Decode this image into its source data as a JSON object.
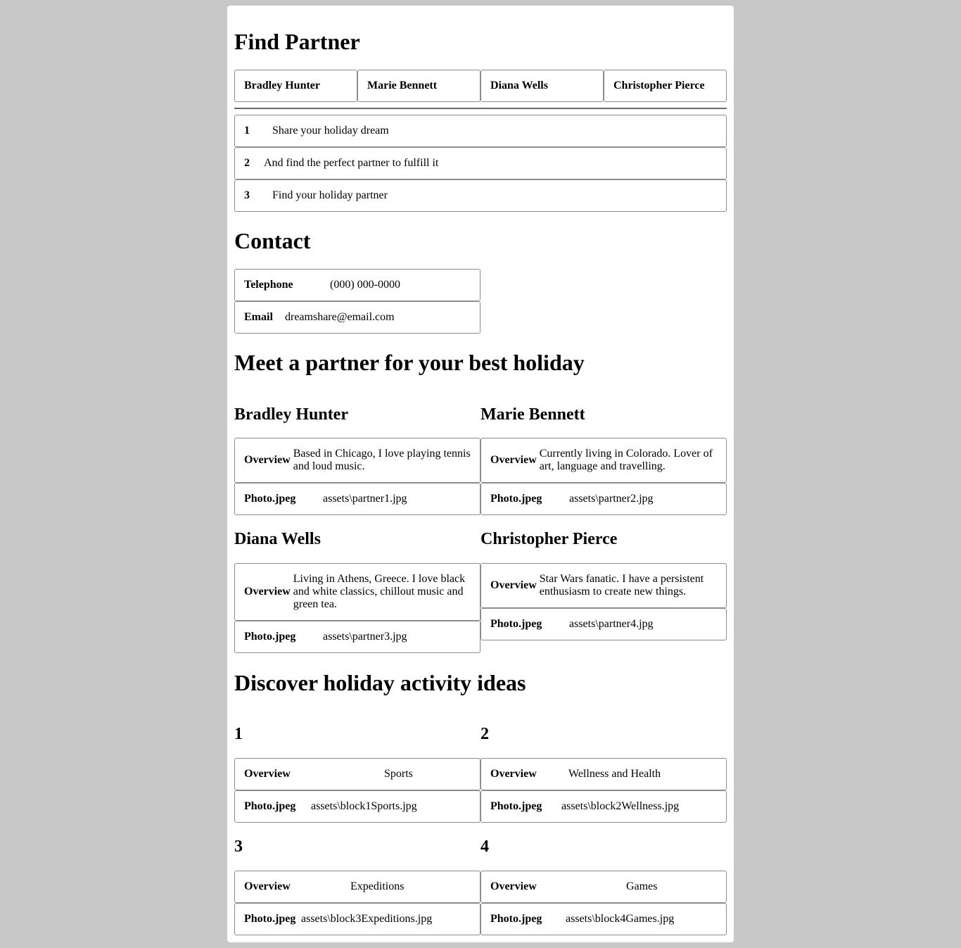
{
  "find": {
    "title": "Find Partner",
    "tabs": [
      "Bradley Hunter",
      "Marie Bennett",
      "Diana Wells",
      "Christopher Pierce"
    ],
    "steps": [
      {
        "num": "1",
        "text": "Share your holiday dream"
      },
      {
        "num": "2",
        "text": "And find the perfect partner to fulfill it"
      },
      {
        "num": "3",
        "text": "Find your holiday partner"
      }
    ]
  },
  "contact": {
    "title": "Contact",
    "telephone_label": "Telephone",
    "telephone_value": "(000) 000-0000",
    "email_label": "Email",
    "email_value": "dreamshare@email.com"
  },
  "partners": {
    "title": "Meet a partner for your best holiday",
    "overview_label": "Overview",
    "photo_label": "Photo.jpeg",
    "items": [
      {
        "name": "Bradley Hunter",
        "overview": "Based in Chicago, I love playing tennis and loud music.",
        "photo": "assets\\partner1.jpg"
      },
      {
        "name": "Marie Bennett",
        "overview": "Currently living in Colorado. Lover of art, language and travelling.",
        "photo": "assets\\partner2.jpg"
      },
      {
        "name": "Diana Wells",
        "overview": "Living in Athens, Greece. I love black and white classics, chillout music and green tea.",
        "photo": "assets\\partner3.jpg"
      },
      {
        "name": "Christopher Pierce",
        "overview": "Star Wars fanatic. I have a persistent enthusiasm to create new things.",
        "photo": "assets\\partner4.jpg"
      }
    ]
  },
  "activities": {
    "title": "Discover holiday activity ideas",
    "overview_label": "Overview",
    "photo_label": "Photo.jpeg",
    "items": [
      {
        "num": "1",
        "overview": "Sports",
        "photo": "assets\\block1Sports.jpg"
      },
      {
        "num": "2",
        "overview": "Wellness and Health",
        "photo": "assets\\block2Wellness.jpg"
      },
      {
        "num": "3",
        "overview": "Expeditions",
        "photo": "assets\\block3Expeditions.jpg"
      },
      {
        "num": "4",
        "overview": "Games",
        "photo": "assets\\block4Games.jpg"
      }
    ]
  }
}
